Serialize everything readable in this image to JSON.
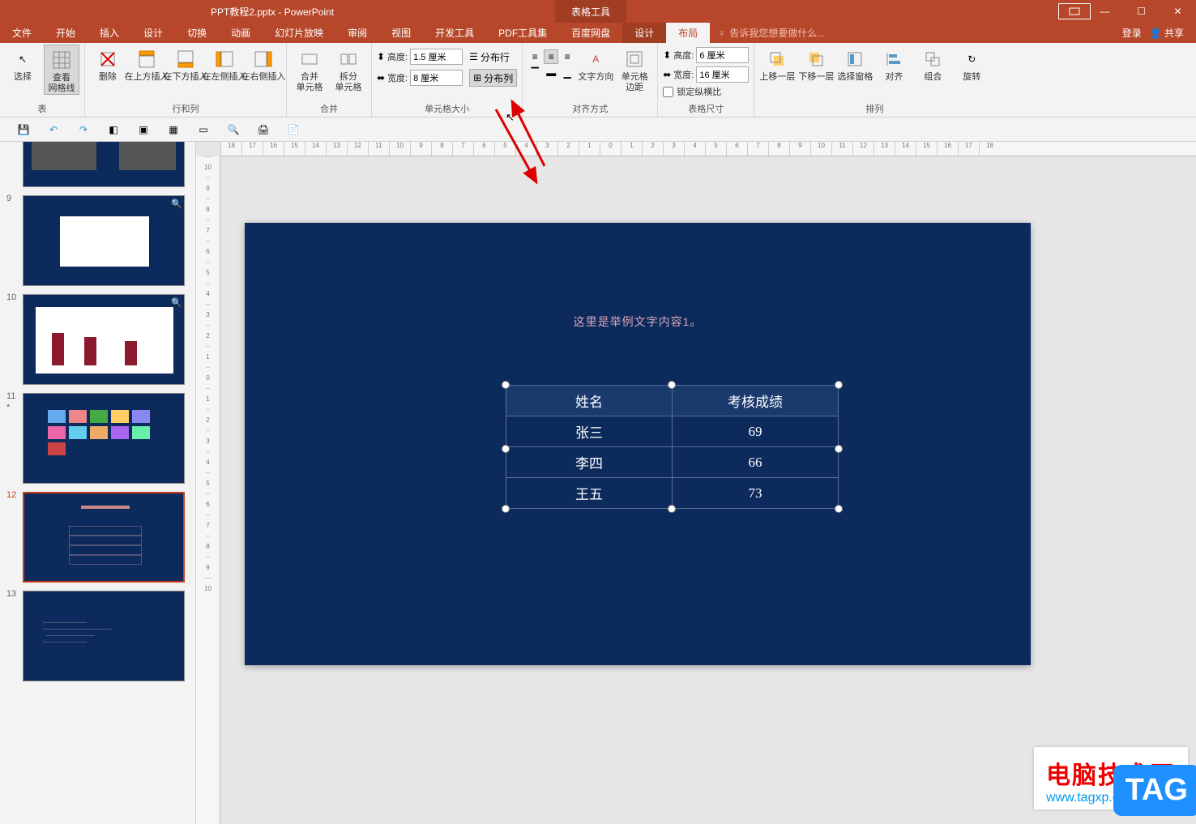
{
  "title": {
    "filename": "PPT教程2.pptx - PowerPoint",
    "tool_context": "表格工具"
  },
  "menubar": {
    "tabs": [
      "文件",
      "开始",
      "插入",
      "设计",
      "切换",
      "动画",
      "幻灯片放映",
      "审阅",
      "视图",
      "开发工具",
      "PDF工具集",
      "百度网盘"
    ],
    "context_tabs": [
      "设计",
      "布局"
    ],
    "tell_me": "告诉我您想要做什么...",
    "login": "登录",
    "share": "共享"
  },
  "ribbon": {
    "table": {
      "select": "选择",
      "view_gridlines": "查看\n网格线",
      "group": "表"
    },
    "rows_cols": {
      "delete": "删除",
      "insert_above": "在上方插入",
      "insert_below": "在下方插入",
      "insert_left": "在左侧插入",
      "insert_right": "在右侧插入",
      "group": "行和列"
    },
    "merge": {
      "merge": "合并\n单元格",
      "split": "拆分\n单元格",
      "group": "合并"
    },
    "cell_size": {
      "height_lbl": "高度:",
      "height_val": "1.5 厘米",
      "width_lbl": "宽度:",
      "width_val": "8 厘米",
      "dist_rows": "分布行",
      "dist_cols": "分布列",
      "group": "单元格大小"
    },
    "align": {
      "text_dir": "文字方向",
      "cell_margins": "单元格\n边距",
      "group": "对齐方式"
    },
    "table_size": {
      "height_lbl": "高度:",
      "height_val": "6 厘米",
      "width_lbl": "宽度:",
      "width_val": "16 厘米",
      "lock": "锁定纵横比",
      "group": "表格尺寸"
    },
    "arrange": {
      "forward": "上移一层",
      "backward": "下移一层",
      "selection_pane": "选择窗格",
      "align": "对齐",
      "group_btn": "组合",
      "rotate": "旋转",
      "group": "排列"
    }
  },
  "slides": {
    "numbers": [
      "9",
      "10",
      "11",
      "12",
      "13"
    ],
    "star": "*",
    "selected": 4
  },
  "slide_content": {
    "title": "这里是举例文字内容1。",
    "table": {
      "headers": [
        "姓名",
        "考核成绩"
      ],
      "rows": [
        [
          "张三",
          "69"
        ],
        [
          "李四",
          "66"
        ],
        [
          "王五",
          "73"
        ]
      ]
    }
  },
  "ruler_marks_h": [
    "18",
    "17",
    "16",
    "15",
    "14",
    "13",
    "12",
    "11",
    "10",
    "9",
    "8",
    "7",
    "6",
    "5",
    "4",
    "3",
    "2",
    "1",
    "0",
    "1",
    "2",
    "3",
    "4",
    "5",
    "6",
    "7",
    "8",
    "9",
    "10",
    "11",
    "12",
    "13",
    "14",
    "15",
    "16",
    "17",
    "18"
  ],
  "ruler_marks_v": [
    "10",
    "9",
    "8",
    "7",
    "6",
    "5",
    "4",
    "3",
    "2",
    "1",
    "0",
    "1",
    "2",
    "3",
    "4",
    "5",
    "6",
    "7",
    "8",
    "9",
    "10"
  ],
  "watermark": {
    "cn": "电脑技术网",
    "en": "www.tagxp.com",
    "tag": "TAG"
  }
}
